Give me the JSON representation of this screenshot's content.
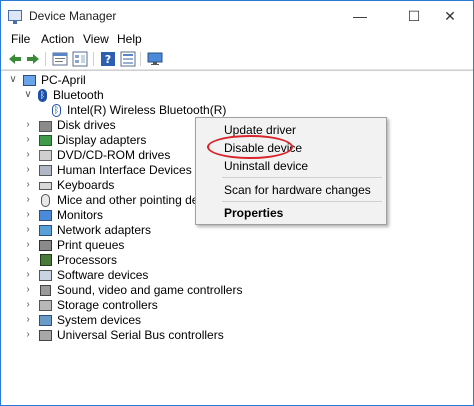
{
  "window": {
    "title": "Device Manager",
    "controls": {
      "minimize": "—",
      "maximize": "☐",
      "close": "✕"
    }
  },
  "menu": [
    "File",
    "Action",
    "View",
    "Help"
  ],
  "toolbar": {
    "icons": [
      "back-icon",
      "forward-icon",
      "properties-icon",
      "console-tree-icon",
      "help-icon",
      "toolbar-grid-icon",
      "monitor-icon"
    ]
  },
  "tree": {
    "root": "PC-April",
    "bluetooth": {
      "label": "Bluetooth",
      "child": "Intel(R) Wireless Bluetooth(R)"
    },
    "categories": [
      {
        "label": "Disk drives",
        "icon": "disk-drive-icon"
      },
      {
        "label": "Display adapters",
        "icon": "display-adapter-icon"
      },
      {
        "label": "DVD/CD-ROM drives",
        "icon": "dvd-drive-icon"
      },
      {
        "label": "Human Interface Devices",
        "icon": "hid-icon"
      },
      {
        "label": "Keyboards",
        "icon": "keyboard-icon"
      },
      {
        "label": "Mice and other pointing devices",
        "icon": "mouse-icon"
      },
      {
        "label": "Monitors",
        "icon": "monitor-icon"
      },
      {
        "label": "Network adapters",
        "icon": "network-adapter-icon"
      },
      {
        "label": "Print queues",
        "icon": "printer-icon"
      },
      {
        "label": "Processors",
        "icon": "processor-icon"
      },
      {
        "label": "Software devices",
        "icon": "software-device-icon"
      },
      {
        "label": "Sound, video and game controllers",
        "icon": "speaker-icon"
      },
      {
        "label": "Storage controllers",
        "icon": "storage-controller-icon"
      },
      {
        "label": "System devices",
        "icon": "system-device-icon"
      },
      {
        "label": "Universal Serial Bus controllers",
        "icon": "usb-icon"
      }
    ]
  },
  "context_menu": {
    "update": "Update driver",
    "disable": "Disable device",
    "uninstall": "Uninstall device",
    "scan": "Scan for hardware changes",
    "properties": "Properties"
  },
  "colors": {
    "window_border": "#2b7bd6",
    "highlight_ring": "#d9232a",
    "menu_bg": "#f2f2f2"
  }
}
